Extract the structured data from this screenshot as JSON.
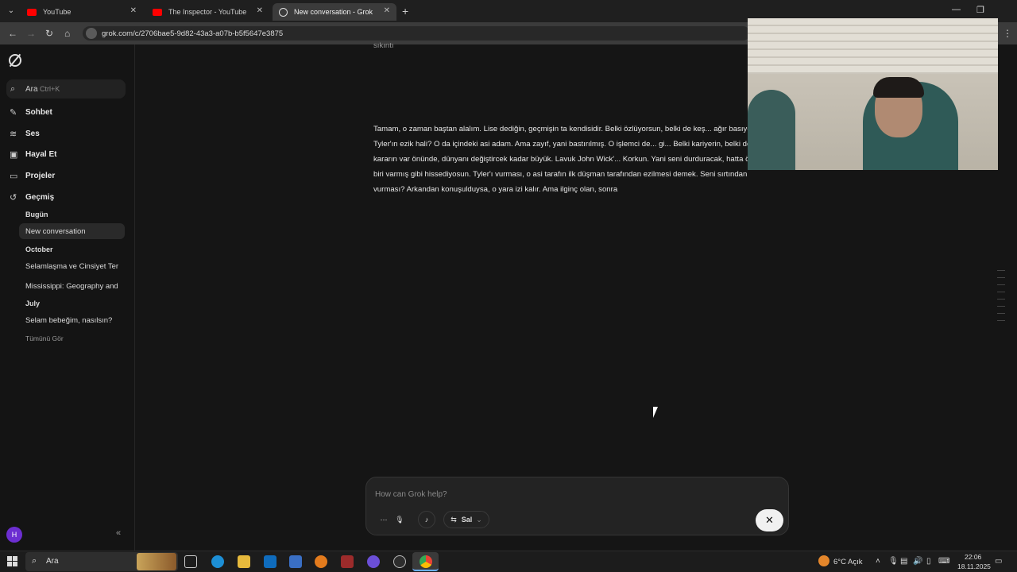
{
  "browser": {
    "tabs": [
      {
        "title": "YouTube",
        "icon": "youtube-icon"
      },
      {
        "title": "The Inspector - YouTube",
        "icon": "youtube-icon"
      },
      {
        "title": "New conversation - Grok",
        "icon": "grok-icon",
        "active": true
      }
    ],
    "url": "grok.com/c/2706bae5-9d82-43a3-a07b-b5f5647e3875"
  },
  "sidebar": {
    "search_label": "Ara",
    "search_shortcut": "Ctrl+K",
    "nav": [
      {
        "label": "Sohbet",
        "icon": "edit-icon"
      },
      {
        "label": "Ses",
        "icon": "waveform-icon"
      },
      {
        "label": "Hayal Et",
        "icon": "image-icon"
      },
      {
        "label": "Projeler",
        "icon": "folder-icon"
      },
      {
        "label": "Geçmiş",
        "icon": "history-icon"
      }
    ],
    "history": {
      "today_label": "Bugün",
      "today_items": [
        "New conversation"
      ],
      "october_label": "October",
      "october_items": [
        "Selamlaşma ve Cinsiyet Ter",
        "Mississippi: Geography and"
      ],
      "july_label": "July",
      "july_items": [
        "Selam bebeğim, nasılsın?"
      ],
      "see_all": "Tümünü Gör"
    },
    "avatar_letter": "H",
    "collapse_icon": "«"
  },
  "conversation": {
    "clipped_top": "sıkıntı",
    "message": "Tamam, o zaman baştan alalım. Lise dediğin, geçmişin ta kendisidir. Belki özlüyorsun, belki de keş... ağır basıyo. Tyler'ın ezik hali? O da içindeki asi adam. Ama zayıf, yani bastırılmış. O işlemci de... gi... Belki kariyerin, belki de bi kararın var önünde, dünyanı değiştircek kadar büyük. Lavuk John Wick'... Korkun. Yani seni durduracak, hatta öldürecek biri varmış gibi hissediyosun. Tyler'ı vurması, o asi tarafın ilk düşman tarafından ezilmesi demek. Seni sırtından vurması? Arkandan konuşulduysa, o yara izi kalır. Ama ilginç olan, sonra"
  },
  "composer": {
    "placeholder": "How can Grok help?",
    "model_label": "Sal",
    "stop_icon": "✕"
  },
  "taskbar": {
    "search_label": "Ara",
    "weather": "6°C  Açık",
    "time": "22:06",
    "date": "18.11.2025"
  },
  "colors": {
    "page_bg": "#151515",
    "youtube_red": "#ff0000",
    "accent_active": "#6ab0ff"
  }
}
